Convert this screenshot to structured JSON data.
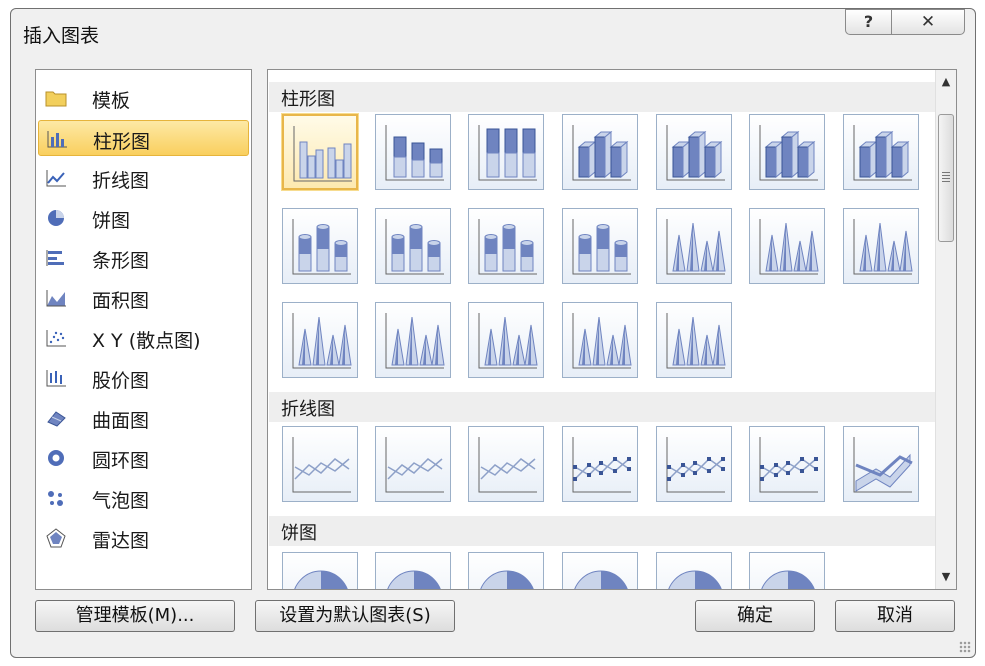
{
  "dialog": {
    "title": "插入图表",
    "help_label": "?",
    "close_label": "✕"
  },
  "categories": [
    {
      "label": "模板",
      "icon": "folder-icon"
    },
    {
      "label": "柱形图",
      "icon": "column-chart-icon",
      "selected": true
    },
    {
      "label": "折线图",
      "icon": "line-chart-icon"
    },
    {
      "label": "饼图",
      "icon": "pie-chart-icon"
    },
    {
      "label": "条形图",
      "icon": "bar-chart-icon"
    },
    {
      "label": "面积图",
      "icon": "area-chart-icon"
    },
    {
      "label": "X Y (散点图)",
      "icon": "scatter-chart-icon"
    },
    {
      "label": "股价图",
      "icon": "stock-chart-icon"
    },
    {
      "label": "曲面图",
      "icon": "surface-chart-icon"
    },
    {
      "label": "圆环图",
      "icon": "doughnut-chart-icon"
    },
    {
      "label": "气泡图",
      "icon": "bubble-chart-icon"
    },
    {
      "label": "雷达图",
      "icon": "radar-chart-icon"
    }
  ],
  "gallery": {
    "sections": [
      {
        "label": "柱形图",
        "thumbs": [
          "clustered-column",
          "stacked-column",
          "100-stacked-column",
          "3d-clustered-column",
          "3d-stacked-column",
          "3d-100-stacked-column",
          "3d-column",
          "clustered-cylinder",
          "stacked-cylinder",
          "100-stacked-cylinder",
          "3d-cylinder",
          "clustered-cone",
          "stacked-cone",
          "100-stacked-cone",
          "3d-cone",
          "clustered-pyramid",
          "stacked-pyramid",
          "100-stacked-pyramid",
          "3d-pyramid"
        ]
      },
      {
        "label": "折线图",
        "thumbs": [
          "line",
          "stacked-line",
          "100-stacked-line",
          "line-with-markers",
          "stacked-line-with-markers",
          "100-stacked-line-with-markers",
          "3d-line"
        ]
      },
      {
        "label": "饼图",
        "thumbs": [
          "pie",
          "3d-pie",
          "pie-of-pie",
          "exploded-pie",
          "3d-exploded-pie",
          "bar-of-pie"
        ]
      }
    ]
  },
  "buttons": {
    "manage_templates": "管理模板(M)...",
    "set_default": "设置为默认图表(S)",
    "ok": "确定",
    "cancel": "取消"
  },
  "colors": {
    "bar_dark": "#6f84c0",
    "bar_light": "#c9d4ea",
    "selection_gold": "#f9cf5e"
  }
}
